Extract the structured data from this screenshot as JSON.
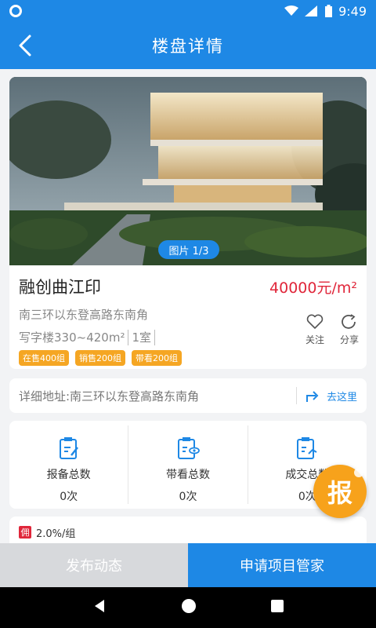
{
  "status_bar": {
    "time": "9:49"
  },
  "header": {
    "title": "楼盘详情"
  },
  "property": {
    "image_counter": "图片 1/3",
    "name": "融创曲江印",
    "price": "40000元/m²",
    "location": "南三环以东登高路东南角",
    "type": "写字楼330~420m²",
    "rooms": "1室",
    "tags": [
      "在售400组",
      "销售200组",
      "带看200组"
    ],
    "actions": {
      "follow": "关注",
      "share": "分享"
    }
  },
  "address": {
    "text": "详细地址:南三环以东登高路东南角",
    "go": "去这里"
  },
  "stats": [
    {
      "label": "报备总数",
      "value": "0次"
    },
    {
      "label": "带看总数",
      "value": "0次"
    },
    {
      "label": "成交总数",
      "value": "0次"
    }
  ],
  "commission": {
    "badge": "佣",
    "text": "2.0%/组"
  },
  "report_badge": "报",
  "bottom": {
    "left": "发布动态",
    "right": "申请项目管家"
  },
  "colors": {
    "primary": "#1e88e5",
    "price": "#e0263a",
    "tag": "#f5a623"
  }
}
